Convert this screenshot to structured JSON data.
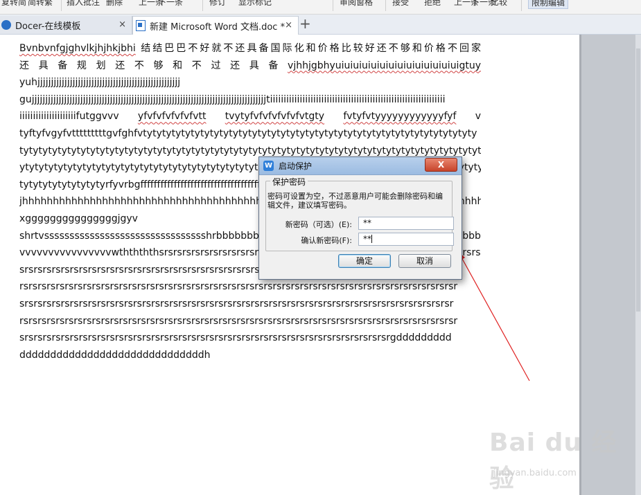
{
  "ribbon": {
    "items": [
      "复转简",
      "简转繁",
      "插入批注",
      "删除",
      "上一条",
      "下一条",
      "修订",
      "显示标记",
      "审阅窗格",
      "接受",
      "拒绝",
      "上一条",
      "下一条",
      "比较",
      "限制编辑"
    ]
  },
  "tabs": [
    {
      "label": "Docer-在线模板",
      "close": "×"
    },
    {
      "label": "新建 Microsoft Word 文档.doc *",
      "close": "×"
    }
  ],
  "tab_add": "+",
  "document": {
    "lines": [
      {
        "segments": [
          {
            "text": "Bvnbvnfgjghvlkjhjhkjbhi",
            "wavy": true
          },
          {
            "text": " 结结巴巴不好就不还具备国际化和价格比较好还不够和价格不回家",
            "wavy": false
          }
        ],
        "justify": true
      },
      {
        "segments": [
          {
            "text": "还 具 备 规 划 还 不 够 和 不 过 还 具 备 ",
            "wavy": false
          },
          {
            "text": "vjhhjgbhyuiuiuiuiuiuiuiuiuiuiuiuiuiuigtuy",
            "wavy": true
          }
        ],
        "justify": true
      },
      {
        "segments": [
          {
            "text": "yuhjjjjjjjjjjjjjjjjjjjjjjjjjjjjjjjjjjjjjjjjjjjjjjjjjjjjj",
            "wavy": false
          }
        ],
        "justify": false
      },
      {
        "segments": [
          {
            "text": "gujjjjjjjjjjjjjjjjjjjjjjjjjjjjjjjjjjjjjjjjjjjjjjjjjjjjjjjjjjjjjjjjjjjjjjjjjjjjjjjjjjjjjjjtiiiiiiiiiiiiiiiiiiiiiiiiiiiiiiiiiiiiiiiiiiiiiiiiiiiiiiiiiiiiiiiii",
            "wavy": false
          }
        ],
        "justify": false
      },
      {
        "segments": [
          {
            "text": "iiiiiiiiiiiiiiiiiiiiifutggvvv ",
            "wavy": false
          },
          {
            "text": "yfvfvfvfvfvfvtt",
            "wavy": true
          },
          {
            "text": " ",
            "wavy": false
          },
          {
            "text": "tvytyfvfvfvfvfvfvtgty",
            "wavy": true
          },
          {
            "text": " ",
            "wavy": false
          },
          {
            "text": "fvtyfvtyyyyyyyyyyyyfyf",
            "wavy": true
          },
          {
            "text": " v",
            "wavy": false
          }
        ],
        "justify": true
      },
      {
        "segments": [
          {
            "text": "tyftyfvgyfvtttttttttgvfghfvtytytytytytytytytytytytytytytytytytytytytytytytytytytytytytytytytytyty",
            "wavy": false
          }
        ],
        "justify": false
      },
      {
        "segments": [
          {
            "text": "tytytytytytytytytytytytytytytytytytytytytytytytytytytytytytytytytytytytytytytytytytytytytytytytytyt",
            "wavy": false
          }
        ],
        "justify": false
      },
      {
        "segments": [
          {
            "text": "ytytytytytytytytytytytytytytytytytytytytytytytytytytytytytytytytytytytytytytytytytytytytytytytytyty",
            "wavy": false
          }
        ],
        "justify": false
      },
      {
        "segments": [
          {
            "text": "tytytytytytytytytyrfyvrbgffffffffffffffffffffffffffffffffffffffffffffffffffffffffffffffffffffffffff",
            "wavy": false
          }
        ],
        "justify": false
      },
      {
        "segments": [
          {
            "text": "jhhhhhhhhhhhhhhhhhhhhhhhhhhhhhhhhhhhhhhhhhhhhhhhhhhhhhhhhhhhhhhhhhhhhhhhhhhhhhhhhhhhhhhhhkkkkk",
            "wavy": false
          }
        ],
        "justify": false
      },
      {
        "segments": [
          {
            "text": "xgggggggggggggggjgyv",
            "wavy": false
          }
        ],
        "justify": false
      },
      {
        "segments": [
          {
            "text": "shrtvsssssssssssssssssssssssssssssssshrbbbbbbbbbbbbbbbbbbbbbbbbbbbbbbbbbbbbbbbbbbbbbbbbbbbbbbbvvv",
            "wavy": false
          }
        ],
        "justify": false
      },
      {
        "segments": [
          {
            "text": "vvvvvvvvvvvvvvvvwththththsrsrsrsrsrsrsrsrsrsrsrsrsrsrsrsrsrsrsrsrsrsrsrsrsrsrsrsrsrsrsrsrsrsrsrsr",
            "wavy": false
          }
        ],
        "justify": false
      },
      {
        "segments": [
          {
            "text": "srsrsrsrsrsrsrsrsrsrsrsrsrsrsrsrsrsrsrsrsrsrsrsrsrsrsrsrsrsrsrsrsrsrsrsrsrsrsrsrsrsrsrsrsrsrsrs",
            "wavy": false
          }
        ],
        "justify": false
      },
      {
        "segments": [
          {
            "text": "rsrsrsrsrsrsrsrsrsrsrsrsrsrsrsrsrsrsrsrsrsrsrsrsrsrsrsrsrsrsrsrsrsrsrsrsrsrsrsrsrsrsrsrsrsrsrsrsr",
            "wavy": false
          }
        ],
        "justify": false
      },
      {
        "segments": [
          {
            "text": "srsrsrsrsrsrsrsrsrsrsrsrsrsrsrsrsrsrsrsrsrsrsrsrsrsrsrsrsrsrsrsrsrsrsrsrsrsrsrsrsrsrsrsrsrsrsrsr",
            "wavy": false
          }
        ],
        "justify": false
      },
      {
        "segments": [
          {
            "text": "rsrsrsrsrsrsrsrsrsrsrsrsrsrsrsrsrsrsrsrsrsrsrsrsrsrsrsrsrsrsrsrsrsrsrsrsrsrsrsrsrsrsrsrsrsrsrsrsr",
            "wavy": false
          }
        ],
        "justify": false
      },
      {
        "segments": [
          {
            "text": "srsrsrsrsrsrsrsrsrsrsrsrsrsrsrsrsrsrsrsrsrsrsrsrsrsrsrsrsrsrsrsrsrsrsrsrsrsrsrsrsrgddddddddd",
            "wavy": false
          }
        ],
        "justify": true
      },
      {
        "segments": [
          {
            "text": "ddddddddddddddddddddddddddddddh",
            "wavy": false
          }
        ],
        "justify": false
      }
    ]
  },
  "dialog": {
    "title": "启动保护",
    "close": "X",
    "group_label": "保护密码",
    "hint": "密码可设置为空，不过恶意用户可能会删除密码和编辑文件，建议填写密码。",
    "new_password_label": "新密码（可选）(E):",
    "new_password_value": "**",
    "confirm_password_label": "确认新密码(F):",
    "confirm_password_value": "**",
    "ok": "确定",
    "cancel": "取消"
  },
  "watermark": {
    "logo": "Bai du 经验",
    "url": "jingyan.baidu.com"
  },
  "colors": {
    "annotation_red": "#e02020",
    "tab_active_bg": "#ffffff",
    "dialog_title_bg": "#9bbbe1"
  }
}
